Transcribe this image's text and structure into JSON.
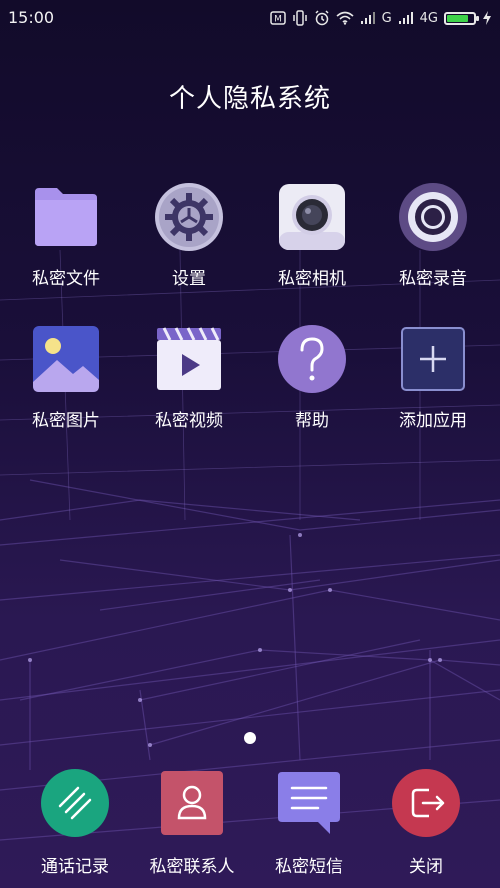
{
  "status_bar": {
    "time": "15:00",
    "network_type": "4G",
    "signal_label": "G",
    "icons": [
      "mail-icon",
      "vibrate-icon",
      "alarm-icon",
      "wifi-icon",
      "signal-icon",
      "signal-icon",
      "battery-icon",
      "charging-icon"
    ],
    "battery_level": 0.8,
    "battery_color": "#3fd24a"
  },
  "page": {
    "title": "个人隐私系统"
  },
  "apps": [
    {
      "label": "私密文件",
      "icon": "folder-icon",
      "color": "#b79cf5"
    },
    {
      "label": "设置",
      "icon": "gear-icon",
      "color": "#a9a4c7"
    },
    {
      "label": "私密相机",
      "icon": "camera-icon",
      "color": "#ecebf5"
    },
    {
      "label": "私密录音",
      "icon": "recorder-icon",
      "color": "#6b5a94"
    },
    {
      "label": "私密图片",
      "icon": "picture-icon",
      "color": "#4a55c9"
    },
    {
      "label": "私密视频",
      "icon": "video-icon",
      "color": "#8a74d8"
    },
    {
      "label": "帮助",
      "icon": "help-icon",
      "color": "#8c6cc8"
    },
    {
      "label": "添加应用",
      "icon": "add-icon",
      "color": "#3a3f78"
    }
  ],
  "dock": [
    {
      "label": "通话记录",
      "icon": "call-log-icon",
      "color": "#1aa57f"
    },
    {
      "label": "私密联系人",
      "icon": "contacts-icon",
      "color": "#c4536a"
    },
    {
      "label": "私密短信",
      "icon": "message-icon",
      "color": "#8a7ee8"
    },
    {
      "label": "关闭",
      "icon": "exit-icon",
      "color": "#c53850"
    }
  ],
  "pager": {
    "current": 1,
    "total": 1
  }
}
